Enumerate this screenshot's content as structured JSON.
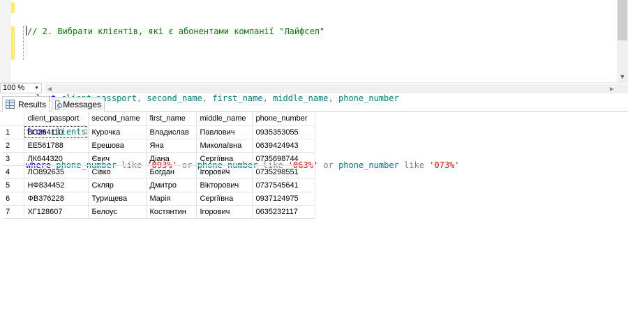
{
  "editor": {
    "lines": [
      {
        "kind": "comment",
        "text": "// 2. Вибрати клієнтів, які є абонентами компанії \"Лайфсел\""
      },
      {
        "kind": "blank"
      },
      {
        "kind": "select",
        "kw": "select",
        "cols": [
          "client_passport",
          "second_name",
          "first_name",
          "middle_name",
          "phone_number"
        ],
        "sep": ", "
      },
      {
        "kind": "from",
        "kw": "from",
        "table": "clients"
      },
      {
        "kind": "where",
        "kw": "where",
        "col": "phone_number",
        "like": "like",
        "or": "or",
        "patterns": [
          "'093%'",
          "'063%'",
          "'073%'"
        ]
      }
    ]
  },
  "zoom": {
    "value": "100 %"
  },
  "tabs": [
    {
      "label": "Results",
      "icon": "grid-icon",
      "active": true
    },
    {
      "label": "Messages",
      "icon": "messages-icon",
      "active": false
    }
  ],
  "results": {
    "columns": [
      "client_passport",
      "second_name",
      "first_name",
      "middle_name",
      "phone_number"
    ],
    "rows": [
      [
        "1",
        "ВС264110",
        "Курочка",
        "Владислав",
        "Павлович",
        "0935353055"
      ],
      [
        "2",
        "ЕЕ561788",
        "Ерешова",
        "Яна",
        "Миколаївна",
        "0639424943"
      ],
      [
        "3",
        "ЛК644320",
        "Євич",
        "Діана",
        "Сергіївна",
        "0735698744"
      ],
      [
        "4",
        "ЛО892635",
        "Сівко",
        "Богдан",
        "Ігорович",
        "0735298551"
      ],
      [
        "5",
        "НФ834452",
        "Скляр",
        "Дмитро",
        "Вікторович",
        "0737545641"
      ],
      [
        "6",
        "ФВ376228",
        "Турищева",
        "Марія",
        "Сергіївна",
        "0937124975"
      ],
      [
        "7",
        "ХГ128607",
        "Белоус",
        "Костянтин",
        "Ігорович",
        "0635232117"
      ]
    ]
  },
  "colors": {
    "keyword": "#0000ff",
    "identifier": "#008080",
    "string": "#ff0000",
    "operator": "#808080",
    "comment": "#008000",
    "change_marker": "#ffef5e"
  }
}
